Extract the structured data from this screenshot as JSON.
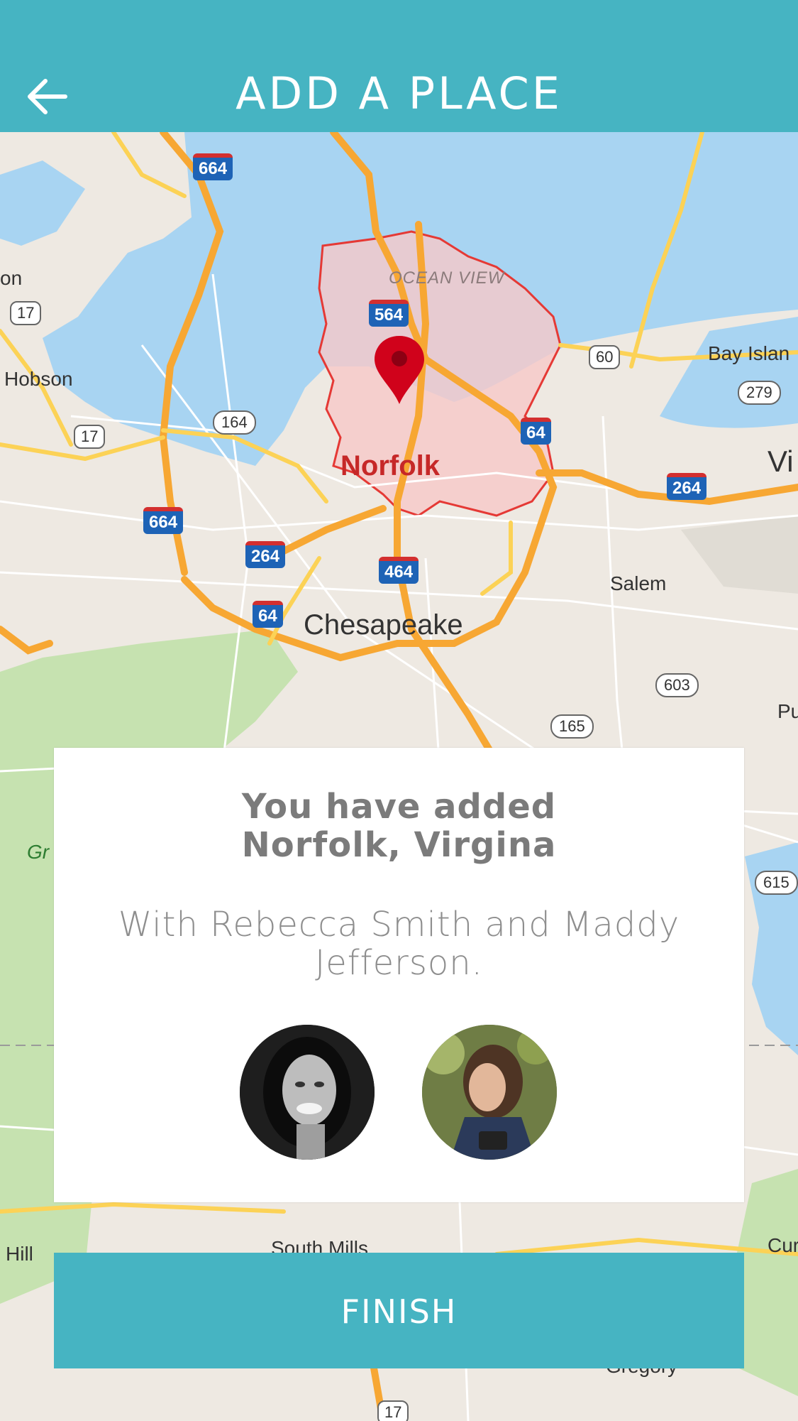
{
  "header": {
    "title": "ADD A PLACE",
    "back_icon": "arrow-left-icon",
    "background": "#46b4c2"
  },
  "map": {
    "labels": {
      "ocean_view": "OCEAN VIEW",
      "norfolk": "Norfolk",
      "chesapeake": "Chesapeake",
      "hobson": "Hobson",
      "bay_island": "Bay Islan",
      "salem": "Salem",
      "south_mills": "South Mills",
      "hill": "Hill",
      "cur": "Cur",
      "pu": "Pu",
      "vi": "Vi",
      "gregory": "Gregory",
      "on": "on",
      "gr": "Gr"
    },
    "shields": {
      "i664_top": "664",
      "i564": "564",
      "i64_east": "64",
      "i264_east": "264",
      "i664_west": "664",
      "i264_west": "264",
      "i464": "464",
      "i64_south": "64",
      "us17_west": "17",
      "us17_mid": "17",
      "us17_bottom": "17",
      "r164": "164",
      "us60": "60",
      "r279": "279",
      "r603": "603",
      "r165": "165",
      "r615": "615"
    },
    "pin_icon": "map-pin-icon",
    "accent_boundary": "#e53935"
  },
  "card": {
    "title_line1": "You have added",
    "title_line2": "Norfolk, Virgina",
    "subtitle": "With Rebecca Smith and Maddy Jefferson.",
    "avatars": [
      "avatar-rebecca",
      "avatar-maddy"
    ]
  },
  "finish": {
    "label": "FINISH"
  }
}
